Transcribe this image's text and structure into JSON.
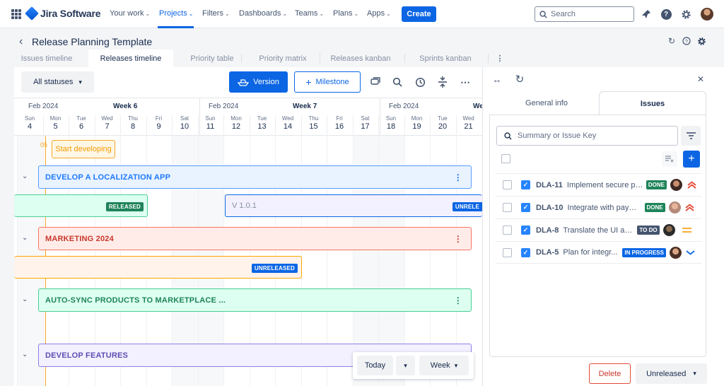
{
  "topnav": {
    "logo_text": "Jira Software",
    "items": [
      {
        "label": "Your work"
      },
      {
        "label": "Projects"
      },
      {
        "label": "Filters"
      },
      {
        "label": "Dashboards"
      },
      {
        "label": "Teams"
      },
      {
        "label": "Plans"
      },
      {
        "label": "Apps"
      }
    ],
    "active_item": "Projects",
    "create_label": "Create",
    "search_placeholder": "Search",
    "icons": [
      "app-switcher-icon",
      "notifications-icon",
      "help-icon",
      "settings-icon",
      "avatar"
    ]
  },
  "page": {
    "title": "Release Planning Template",
    "tabs": [
      {
        "label": "Issues timeline"
      },
      {
        "label": "Releases timeline"
      },
      {
        "label": "Priority table"
      },
      {
        "label": "Priority matrix"
      },
      {
        "label": "Releases kanban"
      },
      {
        "label": "Sprints kanban"
      }
    ],
    "active_tab": "Releases timeline",
    "more_tabs_icon": "more-vertical-icon"
  },
  "toolbar": {
    "status_filter": "All statuses",
    "version_label": "Version",
    "milestone_label": "Milestone"
  },
  "timeline": {
    "weeks": [
      {
        "month": "Feb 2024",
        "week": "Week 6"
      },
      {
        "month": "Feb 2024",
        "week": "Week 7"
      },
      {
        "month": "Feb 2024",
        "week": "We"
      }
    ],
    "days": [
      {
        "n": "Sun",
        "d": "4"
      },
      {
        "n": "Mon",
        "d": "5"
      },
      {
        "n": "Tue",
        "d": "6"
      },
      {
        "n": "Wed",
        "d": "7"
      },
      {
        "n": "Thu",
        "d": "8"
      },
      {
        "n": "Fri",
        "d": "9"
      },
      {
        "n": "Sat",
        "d": "10"
      },
      {
        "n": "Sun",
        "d": "11"
      },
      {
        "n": "Mon",
        "d": "12"
      },
      {
        "n": "Tue",
        "d": "13"
      },
      {
        "n": "Wed",
        "d": "14"
      },
      {
        "n": "Thu",
        "d": "15"
      },
      {
        "n": "Fri",
        "d": "16"
      },
      {
        "n": "Sat",
        "d": "17"
      },
      {
        "n": "Sun",
        "d": "18"
      },
      {
        "n": "Mon",
        "d": "19"
      },
      {
        "n": "Tue",
        "d": "20"
      },
      {
        "n": "Wed",
        "d": "21"
      }
    ],
    "milestone": {
      "day_label": "05",
      "name": "Start developing"
    },
    "groups": [
      {
        "name": "DEVELOP A LOCALIZATION APP",
        "color": "#2684ff"
      },
      {
        "name": "MARKETING 2024",
        "color": "#e34935"
      },
      {
        "name": "AUTO-SYNC PRODUCTS TO MARKETPLACE ...",
        "color": "#1f845a"
      },
      {
        "name": "DEVELOP FEATURES",
        "color": "#6e5dc6"
      }
    ],
    "releases": [
      {
        "lozenge": "RELEASED",
        "lozenge_color": "#1f845a"
      },
      {
        "name": "V 1.0.1",
        "lozenge": "UNRELE",
        "lozenge_color": "#0c66e4"
      },
      {
        "lozenge": "UNRELEASED",
        "lozenge_color": "#0c66e4"
      }
    ],
    "nav": {
      "today_label": "Today",
      "scale_label": "Week"
    }
  },
  "panel": {
    "tabs": [
      {
        "label": "General info"
      },
      {
        "label": "Issues"
      }
    ],
    "active_tab": "Issues",
    "search_placeholder": "Summary or Issue Key",
    "issues": [
      {
        "key": "DLA-11",
        "summary": "Implement secure pa...",
        "status": "DONE",
        "status_color": "#1f845a",
        "priority": "highest"
      },
      {
        "key": "DLA-10",
        "summary": "Integrate with paym...",
        "status": "DONE",
        "status_color": "#1f845a",
        "priority": "highest"
      },
      {
        "key": "DLA-8",
        "summary": "Translate the UI and ...",
        "status": "TO DO",
        "status_color": "#44546f",
        "priority": "medium"
      },
      {
        "key": "DLA-5",
        "summary": "Plan for integr...",
        "status": "IN PROGRESS",
        "status_color": "#0c66e4",
        "priority": "low"
      }
    ],
    "delete_label": "Delete",
    "status_select": "Unreleased"
  }
}
